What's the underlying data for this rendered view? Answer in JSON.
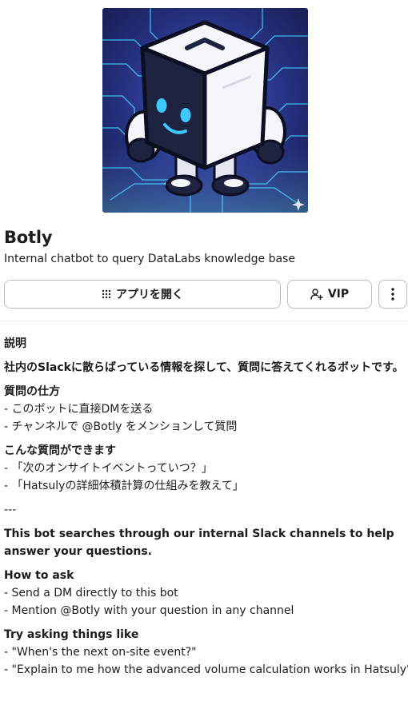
{
  "app": {
    "name": "Botly",
    "description": "Internal chatbot to query DataLabs knowledge base"
  },
  "actions": {
    "open_label": "アプリを開く",
    "vip_label": "VIP",
    "open_icon": "grid-dots-icon",
    "vip_icon": "add-person-icon",
    "more_icon": "vertical-ellipsis-icon"
  },
  "about": {
    "heading": "説明",
    "intro": "社内のSlackに散らばっている情報を探して、質問に答えてくれるボットです。",
    "how_heading": "質問の仕方",
    "how_items": [
      "- このボットに直接DMを送る",
      "- チャンネルで @Botly をメンションして質問"
    ],
    "try_heading": "こんな質問ができます",
    "try_items": [
      "- 「次のオンサイトイベントっていつ？」",
      "- 「Hatsulyの詳細体積計算の仕組みを教えて」"
    ],
    "separator": "---",
    "en_intro": "This bot searches through our internal Slack channels to help answer your questions.",
    "en_how_heading": "How to ask",
    "en_how_items": [
      "- Send a DM directly to this bot",
      "- Mention @Botly with your question in any channel"
    ],
    "en_try_heading": "Try asking things like",
    "en_try_items": [
      "- \"When's the next on-site event?\"",
      "- \"Explain to me how the advanced volume calculation works in Hatsuly\""
    ]
  },
  "colors": {
    "text": "#1d1c1d",
    "border": "#bdbdbd",
    "avatar_bg": "#1b1f5e",
    "circuit": "#3fd0ff",
    "robot_dark": "#1e2340",
    "robot_light": "#f4f6fb",
    "eyes": "#3ec8ff"
  }
}
